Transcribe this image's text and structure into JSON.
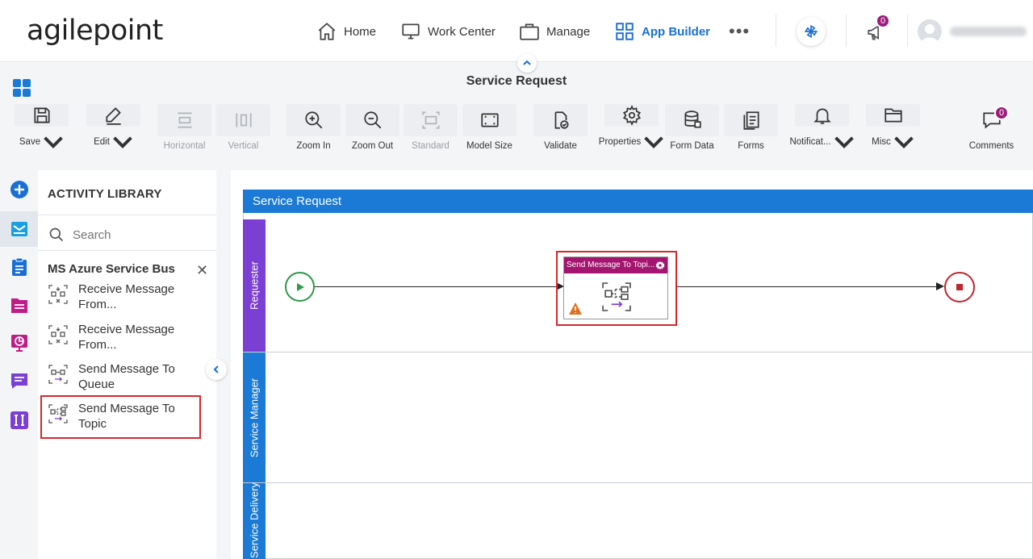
{
  "brand": {
    "logo_text": "agilepoint"
  },
  "nav": {
    "home": "Home",
    "work_center": "Work Center",
    "manage": "Manage",
    "app_builder": "App Builder",
    "more": "•••",
    "notifications_count": "0"
  },
  "page": {
    "title": "Service Request"
  },
  "toolbar": {
    "save": "Save",
    "edit": "Edit",
    "horizontal": "Horizontal",
    "vertical": "Vertical",
    "zoom_in": "Zoom In",
    "zoom_out": "Zoom Out",
    "standard": "Standard",
    "model_size": "Model Size",
    "validate": "Validate",
    "properties": "Properties",
    "form_data": "Form Data",
    "forms": "Forms",
    "notifications": "Notificat...",
    "misc": "Misc",
    "comments": "Comments",
    "comments_count": "0"
  },
  "library": {
    "title": "ACTIVITY LIBRARY",
    "search_placeholder": "Search",
    "category": "MS Azure Service Bus",
    "items": [
      {
        "label": "Receive Message From..."
      },
      {
        "label": "Receive Message From..."
      },
      {
        "label": "Send Message To Queue"
      },
      {
        "label": "Send Message To Topic"
      }
    ]
  },
  "canvas": {
    "pool_title": "Service Request",
    "lanes": [
      "Requester",
      "Service Manager",
      "Service Delivery"
    ],
    "activity_title": "Send Message To Topi..."
  },
  "colors": {
    "accent": "#1a7ad6",
    "lane_purple": "#7b3fd4",
    "activity_header": "#a3156f",
    "highlight": "#d9262b",
    "badge": "#9b1c7c"
  }
}
